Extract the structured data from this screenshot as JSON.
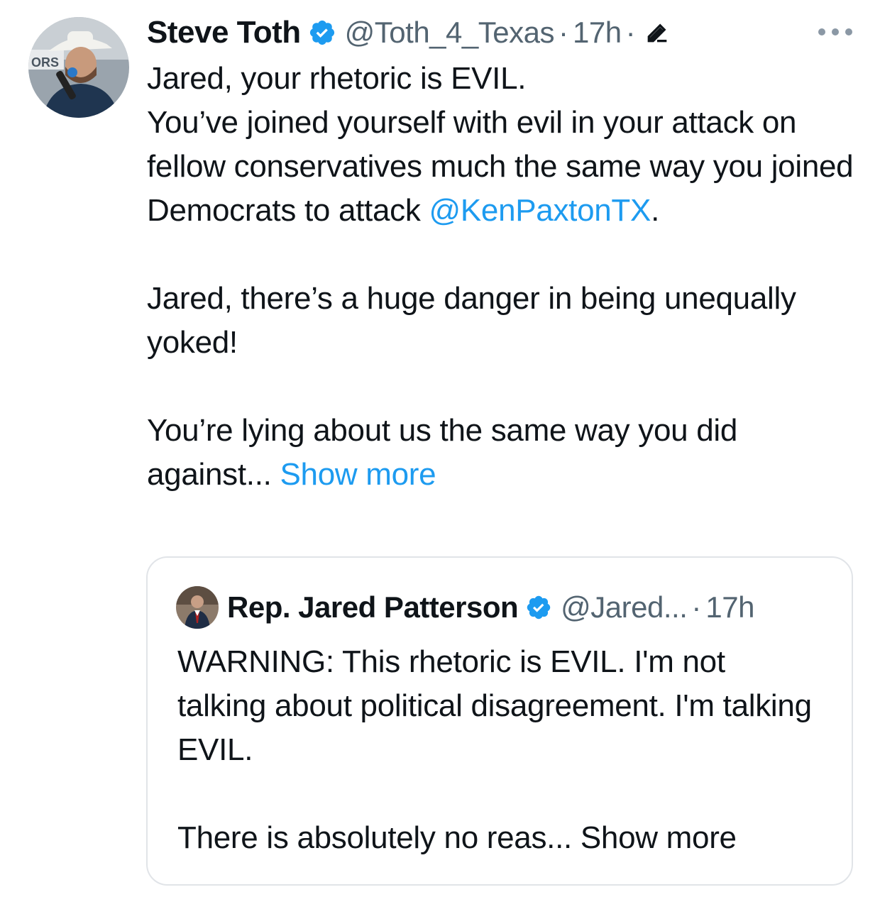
{
  "tweet": {
    "author": {
      "display_name": "Steve Toth",
      "handle": "@Toth_4_Texas",
      "verified": true,
      "time": "17h",
      "separator": "·"
    },
    "text": {
      "line1": "Jared, your rhetoric is EVIL.",
      "line2": "You’ve joined yourself with evil in your attack on fellow conservatives much the same way you joined Democrats to attack ",
      "mention": "@KenPaxtonTX",
      "line2_end": ".",
      "para2": "Jared, there’s a huge danger in being unequally yoked!",
      "para3": "You’re lying about us the same way you did against... ",
      "show_more": "Show more"
    },
    "icons": {
      "verified": "verified-badge-icon",
      "edit": "edit-pencil-icon",
      "more": "more-options-icon"
    },
    "colors": {
      "link": "#1d9bf0",
      "verified": "#1d9bf0",
      "meta": "#536471"
    }
  },
  "quoted_tweet": {
    "author": {
      "display_name": "Rep. Jared Patterson",
      "handle": "@Jared...",
      "verified": true,
      "time": "17h",
      "separator": "·"
    },
    "text": {
      "para1": "WARNING: This rhetoric is EVIL. I'm not talking about political disagreement. I'm talking EVIL.",
      "para2": "There is absolutely no reas... Show more"
    }
  }
}
